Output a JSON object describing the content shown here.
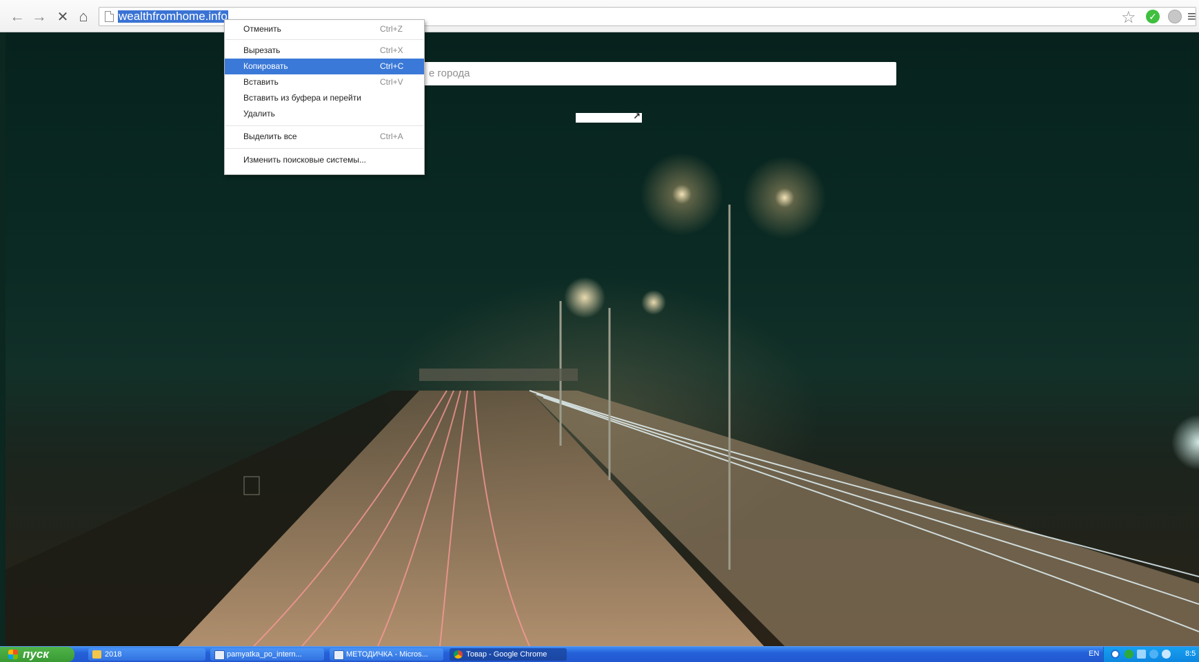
{
  "browser": {
    "url": "wealthfromhome.info"
  },
  "page": {
    "search_placeholder": "е города"
  },
  "context_menu": {
    "items": [
      {
        "label": "Отменить",
        "shortcut": "Ctrl+Z"
      },
      {
        "label": "Вырезать",
        "shortcut": "Ctrl+X"
      },
      {
        "label": "Копировать",
        "shortcut": "Ctrl+C",
        "active": true
      },
      {
        "label": "Вставить",
        "shortcut": "Ctrl+V"
      },
      {
        "label": "Вставить из буфера и перейти",
        "shortcut": ""
      },
      {
        "label": "Удалить",
        "shortcut": ""
      },
      {
        "label": "Выделить все",
        "shortcut": "Ctrl+A"
      },
      {
        "label": "Изменить поисковые системы...",
        "shortcut": ""
      }
    ]
  },
  "taskbar": {
    "start_label": "пуск",
    "tasks": [
      {
        "label": "2018",
        "icon": "folder-icon"
      },
      {
        "label": "pamyatka_po_intern...",
        "icon": "word-icon"
      },
      {
        "label": "МЕТОДИЧКА - Micros...",
        "icon": "word-icon"
      },
      {
        "label": "Товар - Google Chrome",
        "icon": "chrome-icon",
        "active": true
      }
    ],
    "language": "EN",
    "clock": "8:5"
  },
  "colors": {
    "menu_highlight": "#3b79d8",
    "taskbar_blue": "#2461d8",
    "start_green": "#3a9a34"
  }
}
